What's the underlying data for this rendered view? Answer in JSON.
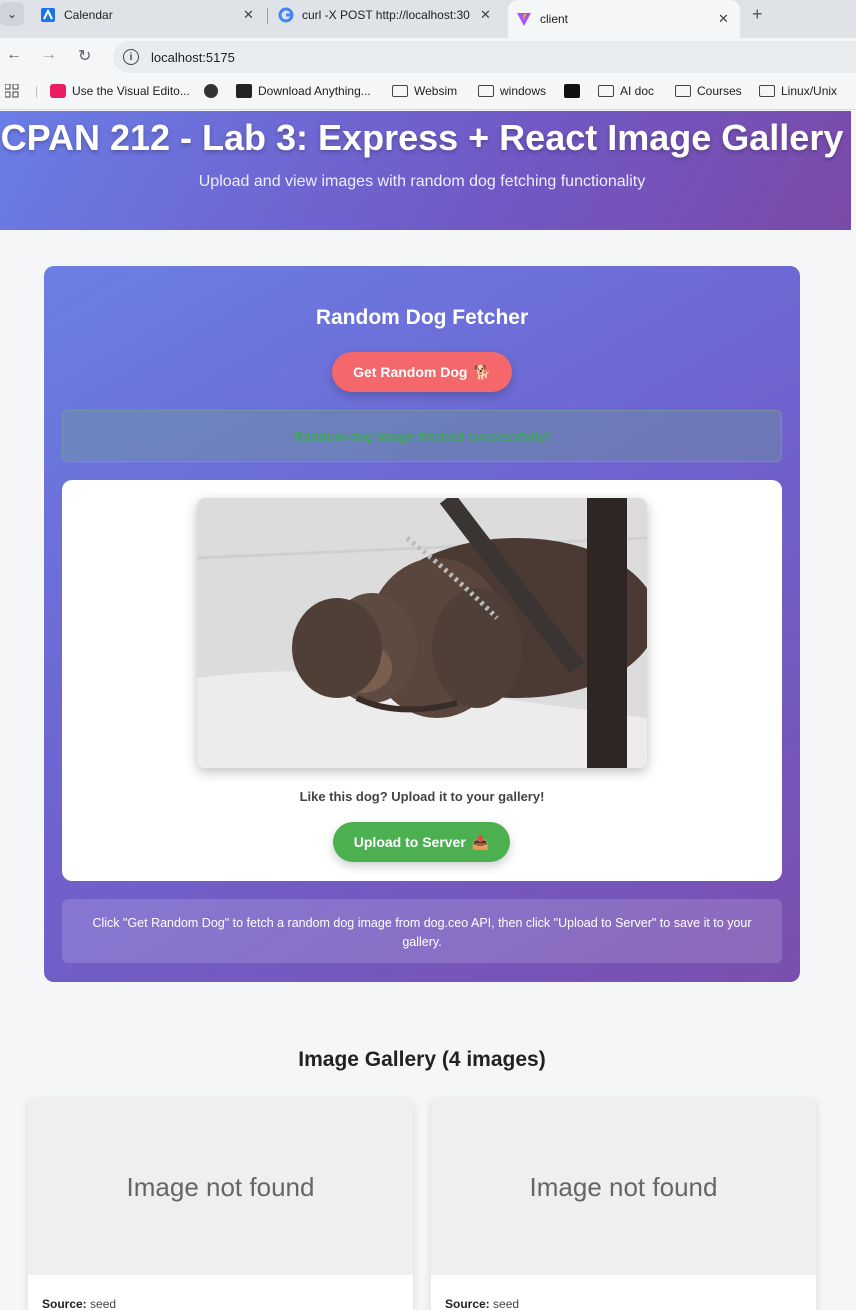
{
  "browser": {
    "tabs": [
      {
        "title": "Calendar",
        "icon": "app-icon"
      },
      {
        "title": "curl -X POST http://localhost:30",
        "icon": "google-icon"
      },
      {
        "title": "client",
        "icon": "vite-icon"
      }
    ],
    "url": "localhost:5175",
    "bookmarks": [
      {
        "label": "Use the Visual Edito...",
        "icon": "bookmark-app-icon"
      },
      {
        "label": "",
        "icon": "globe-icon"
      },
      {
        "label": "Download Anything...",
        "icon": "bookmark-app-icon"
      },
      {
        "label": "Websim",
        "icon": "folder-icon"
      },
      {
        "label": "windows",
        "icon": "folder-icon"
      },
      {
        "label": "",
        "icon": "bookmark-app-icon"
      },
      {
        "label": "AI doc",
        "icon": "folder-icon"
      },
      {
        "label": "Courses",
        "icon": "folder-icon"
      },
      {
        "label": "Linux/Unix",
        "icon": "folder-icon"
      }
    ]
  },
  "header": {
    "title": "CPAN 212 - Lab 3: Express + React Image Gallery",
    "subtitle": "Upload and view images with random dog fetching functionality"
  },
  "fetcher": {
    "title": "Random Dog Fetcher",
    "get_button": "Get Random Dog",
    "get_button_emoji": "🐕",
    "status": "Random dog image fetched successfully!",
    "prompt": "Like this dog? Upload it to your gallery!",
    "upload_button": "Upload to Server",
    "upload_button_emoji": "📤",
    "hint": "Click \"Get Random Dog\" to fetch a random dog image from dog.ceo API, then click \"Upload to Server\" to save it to your gallery."
  },
  "gallery": {
    "title": "Image Gallery (4 images)",
    "items": [
      {
        "placeholder": "Image not found",
        "source_label": "Source:",
        "source": "seed"
      },
      {
        "placeholder": "Image not found",
        "source_label": "Source:",
        "source": "seed"
      }
    ]
  },
  "colors": {
    "accent_gradient_start": "#6a7de6",
    "accent_gradient_end": "#7a4aa8",
    "dog_button": "#f4676a",
    "upload_button": "#4caf50",
    "success_text": "#3ea85a"
  }
}
